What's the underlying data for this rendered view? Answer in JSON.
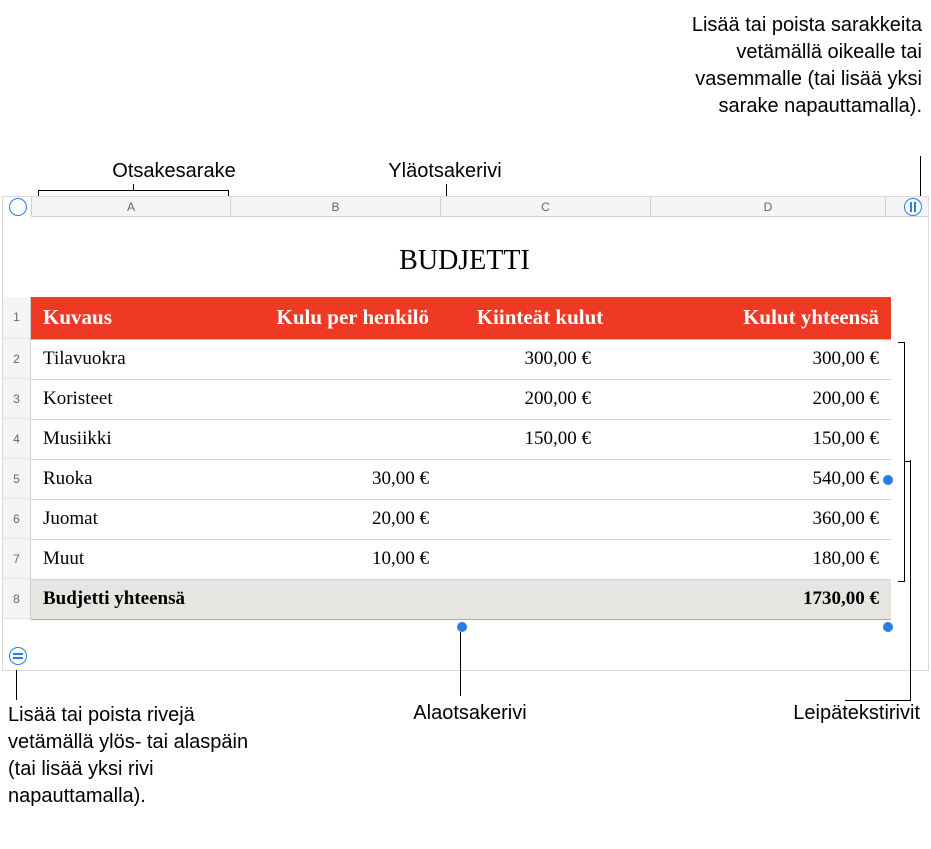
{
  "callouts": {
    "header_column": "Otsakesarake",
    "header_row": "Yläotsakerivi",
    "add_columns": "Lisää tai poista sarakkeita vetämällä oikealle tai vasemmalle (tai lisää yksi sarake napauttamalla).",
    "add_rows": "Lisää tai poista rivejä vetämällä ylös- tai alaspäin (tai lisää yksi rivi napauttamalla).",
    "footer_row": "Alaotsakerivi",
    "body_rows": "Leipätekstirivit"
  },
  "columns": {
    "A": "A",
    "B": "B",
    "C": "C",
    "D": "D"
  },
  "row_numbers": [
    "1",
    "2",
    "3",
    "4",
    "5",
    "6",
    "7",
    "8"
  ],
  "title": "BUDJETTI",
  "headers": {
    "kuvaus": "Kuvaus",
    "kulu_per_henkilo": "Kulu per henkilö",
    "kiinteat_kulut": "Kiinteät kulut",
    "kulut_yhteensa": "Kulut yhteensä"
  },
  "rows": [
    {
      "desc": "Tilavuokra",
      "per": "",
      "fixed": "300,00 €",
      "total": "300,00 €"
    },
    {
      "desc": "Koristeet",
      "per": "",
      "fixed": "200,00 €",
      "total": "200,00 €"
    },
    {
      "desc": "Musiikki",
      "per": "",
      "fixed": "150,00 €",
      "total": "150,00 €"
    },
    {
      "desc": "Ruoka",
      "per": "30,00 €",
      "fixed": "",
      "total": "540,00 €"
    },
    {
      "desc": "Juomat",
      "per": "20,00 €",
      "fixed": "",
      "total": "360,00 €"
    },
    {
      "desc": "Muut",
      "per": "10,00 €",
      "fixed": "",
      "total": "180,00 €"
    }
  ],
  "footer": {
    "label": "Budjetti yhteensä",
    "total": "1730,00 €"
  },
  "colors": {
    "header_bg": "#ee3a24",
    "accent": "#2a7de1"
  }
}
